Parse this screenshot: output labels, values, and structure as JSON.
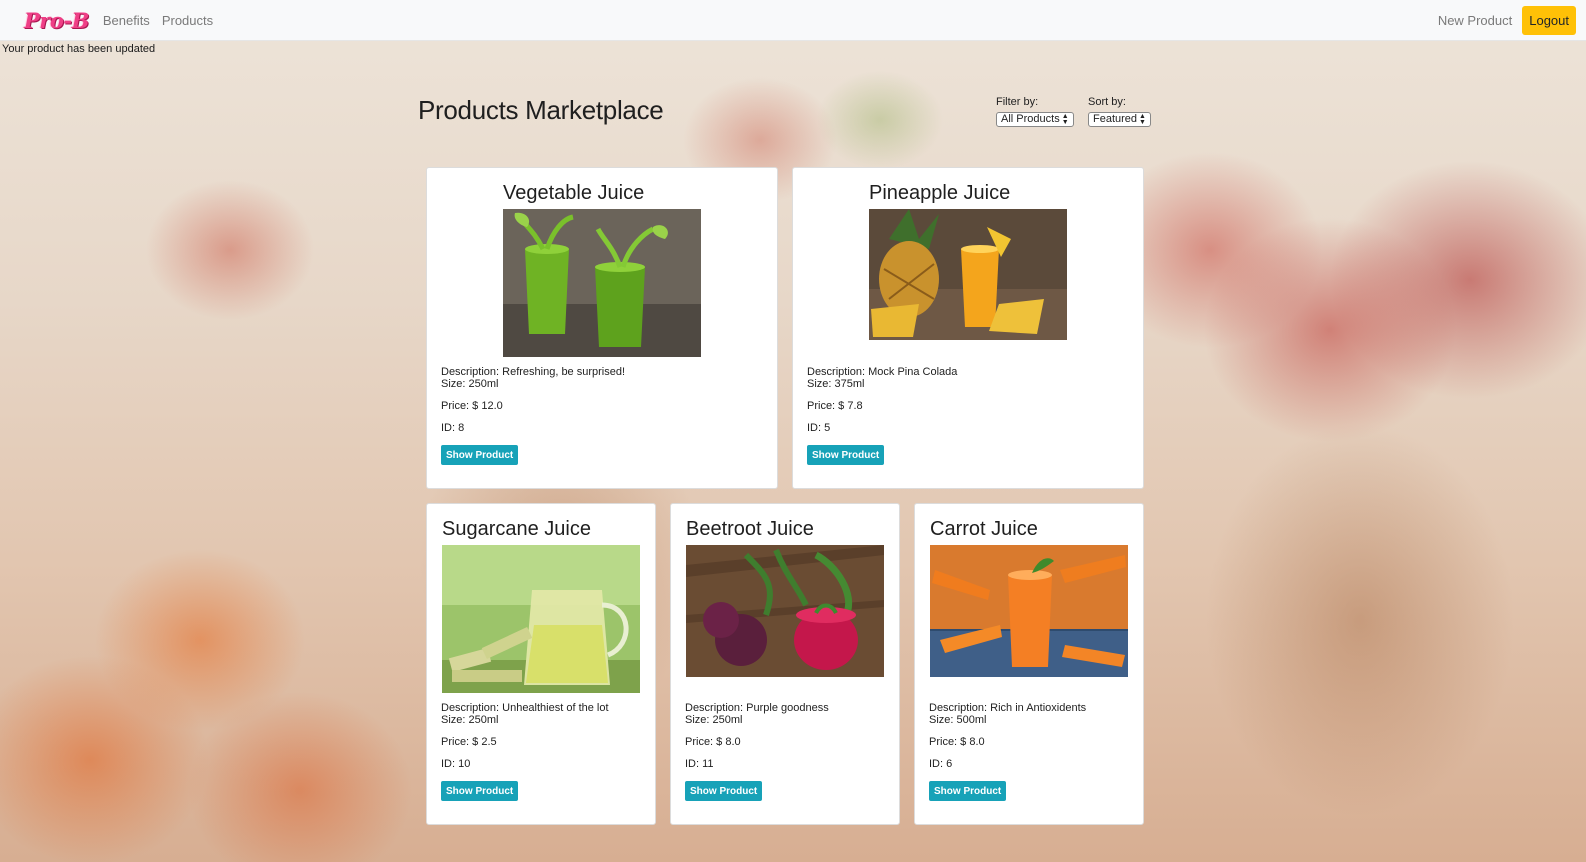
{
  "navbar": {
    "brand": "Pro-B",
    "links": [
      "Benefits",
      "Products"
    ],
    "new_product": "New Product",
    "logout": "Logout"
  },
  "flash": "Your product has been updated",
  "page_title": "Products Marketplace",
  "filter": {
    "label": "Filter by:",
    "selected": "All Products"
  },
  "sort": {
    "label": "Sort by:",
    "selected": "Featured"
  },
  "products": [
    {
      "name": "Vegetable Juice",
      "description": "Description: Refreshing, be surprised!",
      "size": "Size: 250ml",
      "price": "Price: $ 12.0",
      "id": "ID: 8",
      "button": "Show Product",
      "image": "green-juice-image"
    },
    {
      "name": "Pineapple Juice",
      "description": "Description: Mock Pina Colada",
      "size": "Size: 375ml",
      "price": "Price: $ 7.8",
      "id": "ID: 5",
      "button": "Show Product",
      "image": "pineapple-juice-image"
    },
    {
      "name": "Sugarcane Juice",
      "description": "Description: Unhealthiest of the lot",
      "size": "Size: 250ml",
      "price": "Price: $ 2.5",
      "id": "ID: 10",
      "button": "Show Product",
      "image": "sugarcane-juice-image"
    },
    {
      "name": "Beetroot Juice",
      "description": "Description: Purple goodness",
      "size": "Size: 250ml",
      "price": "Price: $ 8.0",
      "id": "ID: 11",
      "button": "Show Product",
      "image": "beetroot-juice-image"
    },
    {
      "name": "Carrot Juice",
      "description": "Description: Rich in Antioxidents",
      "size": "Size: 500ml",
      "price": "Price: $ 8.0",
      "id": "ID: 6",
      "button": "Show Product",
      "image": "carrot-juice-image"
    }
  ]
}
